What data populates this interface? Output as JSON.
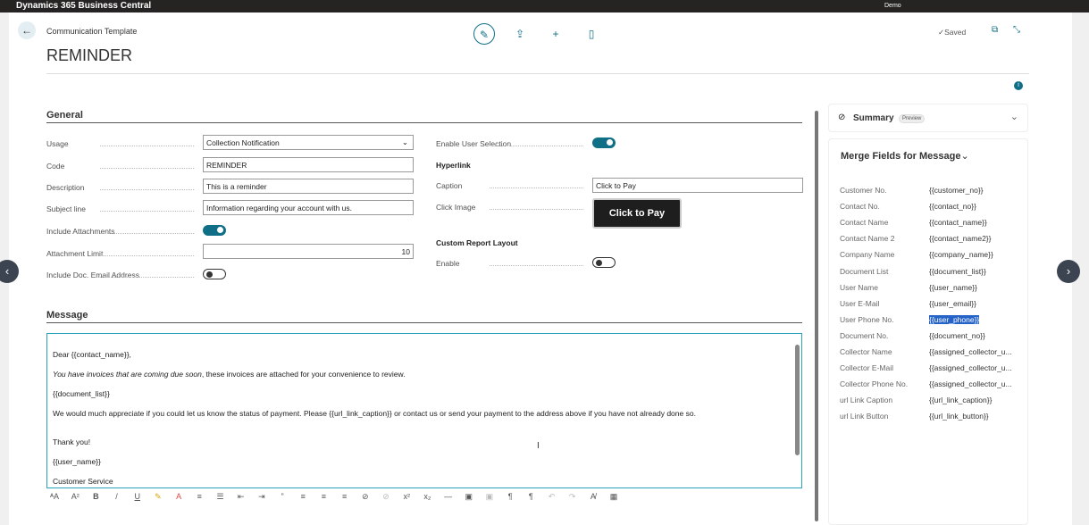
{
  "app": {
    "title": "Dynamics 365 Business Central",
    "company": "Demo"
  },
  "header": {
    "breadcrumb": "Communication Template",
    "title": "REMINDER",
    "status": "✓Saved"
  },
  "general": {
    "heading": "General",
    "usage_label": "Usage",
    "usage_value": "Collection Notification",
    "code_label": "Code",
    "code_value": "REMINDER",
    "description_label": "Description",
    "description_value": "This is a reminder",
    "subject_label": "Subject line",
    "subject_value": "Information regarding your account with us.",
    "include_attachments_label": "Include Attachments",
    "include_attachments": true,
    "attachment_limit_label": "Attachment Limit",
    "attachment_limit_value": "10",
    "include_doc_email_label": "Include Doc. Email Address",
    "include_doc_email": false,
    "enable_user_selection_label": "Enable User Selection",
    "enable_user_selection": true,
    "hyperlink_heading": "Hyperlink",
    "caption_label": "Caption",
    "caption_value": "Click to Pay",
    "click_image_label": "Click Image",
    "click_image_button": "Click to Pay",
    "custom_report_heading": "Custom Report Layout",
    "enable_label": "Enable",
    "enable": false
  },
  "message": {
    "heading": "Message",
    "lines": [
      "Dear {{contact_name}},",
      "You have invoices that are coming due soon",
      "{{document_list}}",
      "We would much appreciate if you could let us know the status of payment. Please {{url_link_caption}} or contact us or send your payment to the address above if you have not already done so.",
      "Thank you!",
      "{{user_name}}",
      "Customer Service"
    ],
    "line2_rest": ", these invoices are attached for your convenience to review."
  },
  "summary": {
    "title": "Summary",
    "badge": "Preview"
  },
  "merge_fields": {
    "title": "Merge Fields for Message",
    "items": [
      {
        "label": "Customer No.",
        "value": "{{customer_no}}"
      },
      {
        "label": "Contact No.",
        "value": "{{contact_no}}"
      },
      {
        "label": "Contact Name",
        "value": "{{contact_name}}"
      },
      {
        "label": "Contact Name 2",
        "value": "{{contact_name2}}"
      },
      {
        "label": "Company Name",
        "value": "{{company_name}}"
      },
      {
        "label": "Document List",
        "value": "{{document_list}}"
      },
      {
        "label": "User Name",
        "value": "{{user_name}}"
      },
      {
        "label": "User E-Mail",
        "value": "{{user_email}}"
      },
      {
        "label": "User Phone No.",
        "value": "{{user_phone}}"
      },
      {
        "label": "Document No.",
        "value": "{{document_no}}"
      },
      {
        "label": "Collector Name",
        "value": "{{assigned_collector_u..."
      },
      {
        "label": "Collector E-Mail",
        "value": "{{assigned_collector_u..."
      },
      {
        "label": "Collector Phone No.",
        "value": "{{assigned_collector_u..."
      },
      {
        "label": "url Link Caption",
        "value": "{{url_link_caption}}"
      },
      {
        "label": "url Link Button",
        "value": "{{url_link_button}}"
      }
    ],
    "selected": "{{user_phone}}"
  },
  "colors": {
    "accent": "#0f6f87",
    "selection": "#2563c9"
  }
}
